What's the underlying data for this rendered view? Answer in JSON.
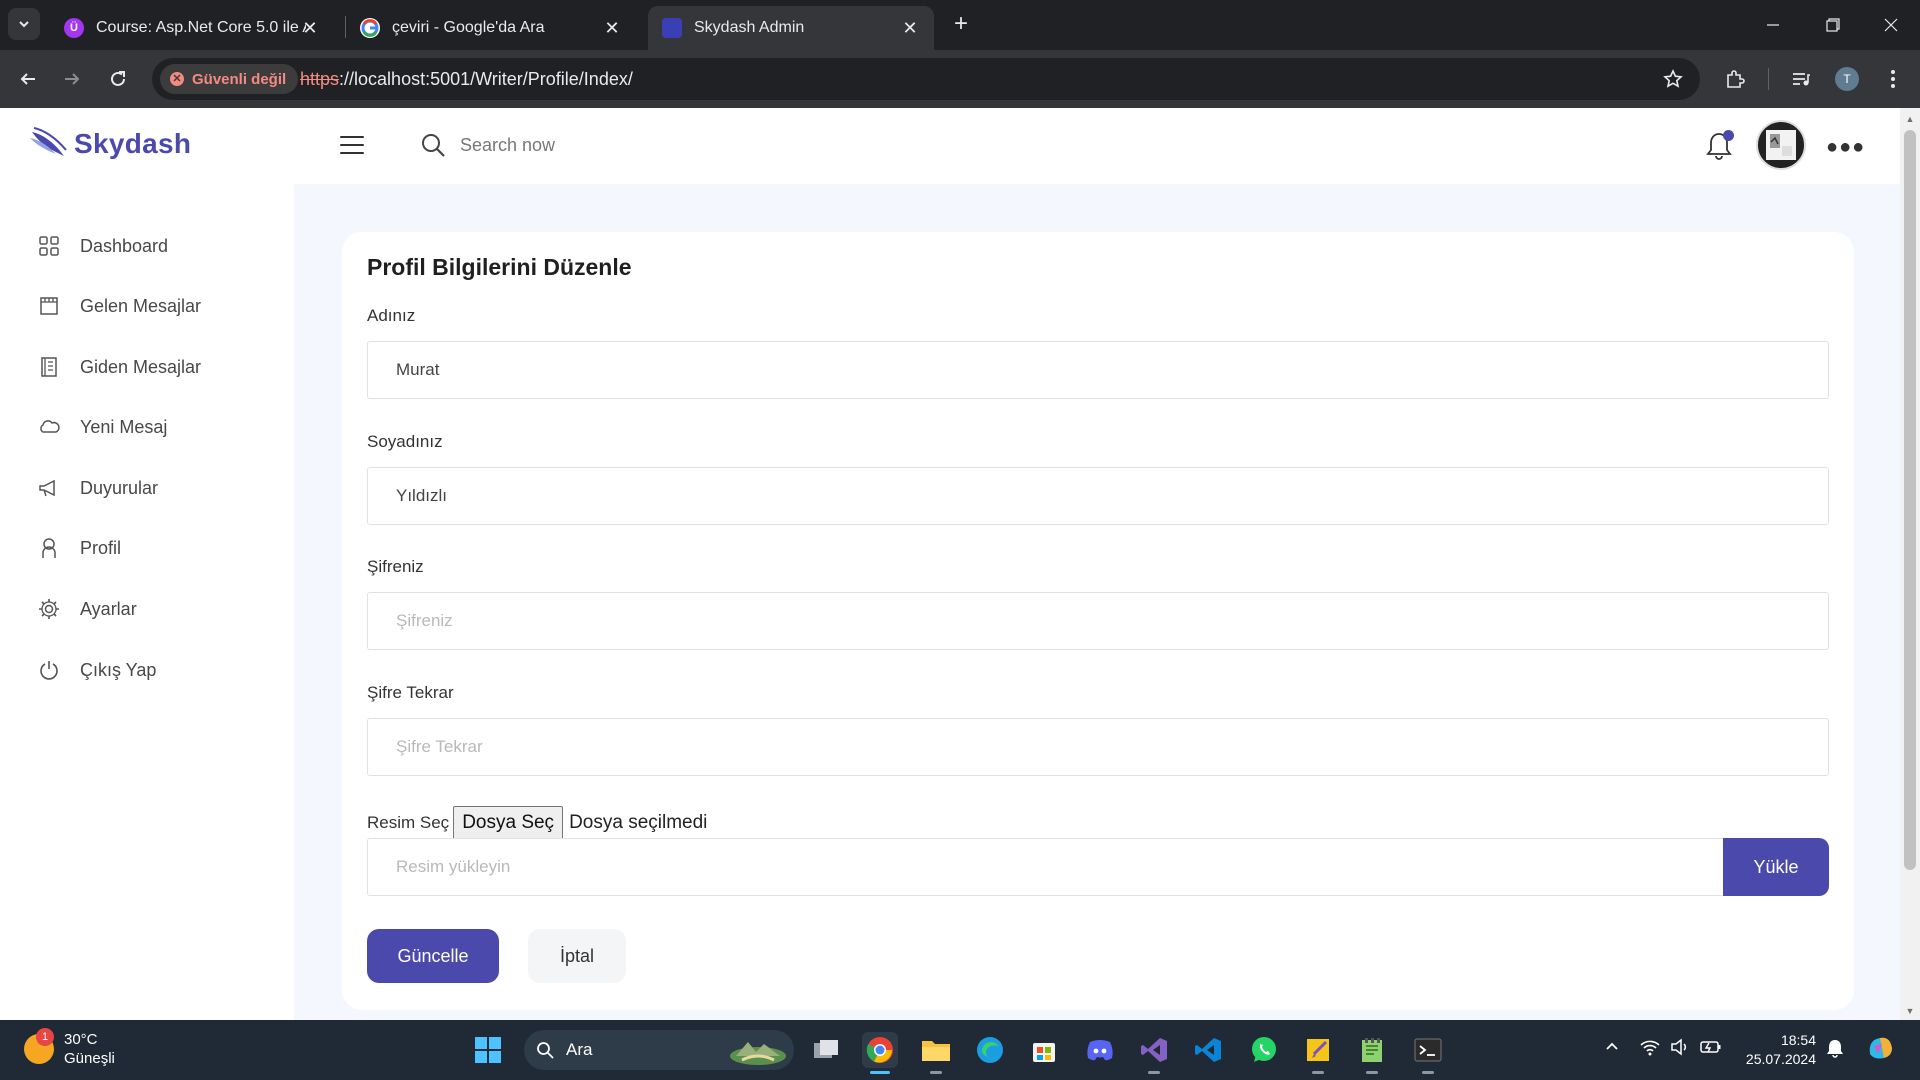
{
  "browser": {
    "tabs": [
      {
        "title": "Course: Asp.Net Core 5.0 ile Ad",
        "favicon": "udemy-icon",
        "favicon_color": "#a435f0"
      },
      {
        "title": "çeviri - Google'da Ara",
        "favicon": "google-icon",
        "favicon_color": "#ffffff"
      },
      {
        "title": "Skydash Admin",
        "favicon": "skydash-icon",
        "favicon_color": "#3b3fb5",
        "active": true
      }
    ],
    "security_label": "Güvenli değil",
    "url_scheme": "https",
    "url_rest": "://localhost:5001/Writer/Profile/Index/",
    "profile_initial": "T"
  },
  "app": {
    "brand": "Skydash",
    "brand_color": "#4b49ac",
    "search_placeholder": "Search now",
    "sidebar": [
      {
        "label": "Dashboard",
        "icon": "grid-icon"
      },
      {
        "label": "Gelen Mesajlar",
        "icon": "inbox-icon"
      },
      {
        "label": "Giden Mesajlar",
        "icon": "outbox-icon"
      },
      {
        "label": "Yeni Mesaj",
        "icon": "cloud-icon"
      },
      {
        "label": "Duyurular",
        "icon": "megaphone-icon"
      },
      {
        "label": "Profil",
        "icon": "user-icon"
      },
      {
        "label": "Ayarlar",
        "icon": "gear-icon"
      },
      {
        "label": "Çıkış Yap",
        "icon": "power-icon"
      }
    ],
    "form": {
      "title": "Profil Bilgilerini Düzenle",
      "first_name_label": "Adınız",
      "first_name_value": "Murat",
      "last_name_label": "Soyadınız",
      "last_name_value": "Yıldızlı",
      "password_label": "Şifreniz",
      "password_placeholder": "Şifreniz",
      "password_repeat_label": "Şifre Tekrar",
      "password_repeat_placeholder": "Şifre Tekrar",
      "image_label": "Resim Seç",
      "file_button": "Dosya Seç",
      "file_status": "Dosya seçilmedi",
      "upload_placeholder": "Resim yükleyin",
      "upload_button": "Yükle",
      "update_button": "Güncelle",
      "cancel_button": "İptal"
    }
  },
  "taskbar": {
    "temperature": "30°C",
    "weather_desc": "Güneşli",
    "weather_badge": "1",
    "search_label": "Ara",
    "time": "18:54",
    "date": "25.07.2024"
  }
}
